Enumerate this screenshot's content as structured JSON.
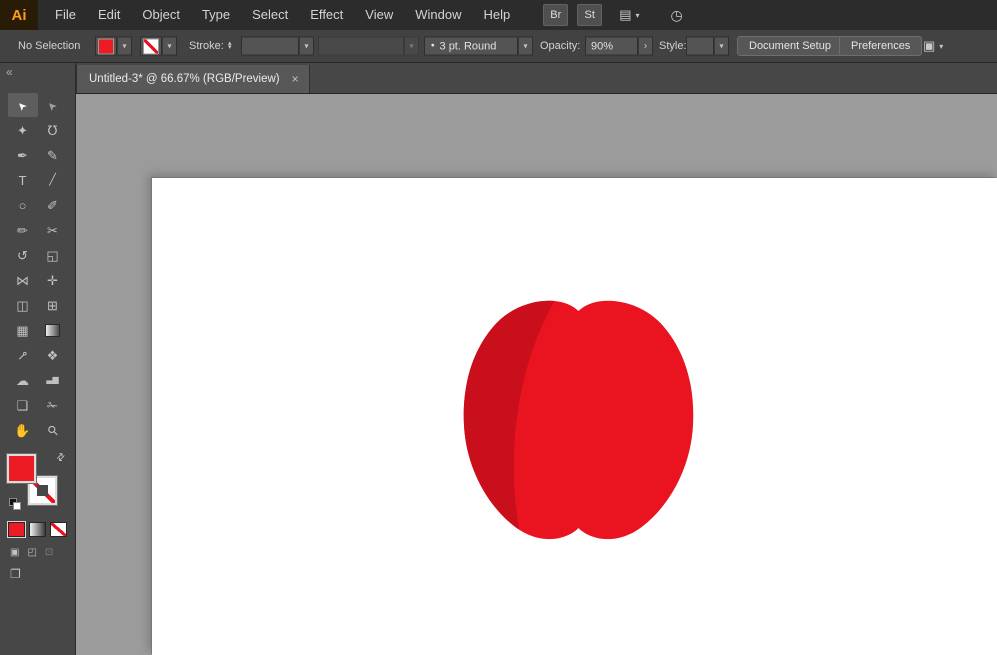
{
  "colors": {
    "swatch_red": "#ed1c24",
    "apple_fill": "#e9141f",
    "apple_shade": "#c90f1c",
    "canvas_gray": "#9b9b9b",
    "artboard_white": "#ffffff"
  },
  "app": {
    "logo_text": "Ai"
  },
  "menubar": {
    "menus": [
      "File",
      "Edit",
      "Object",
      "Type",
      "Select",
      "Effect",
      "View",
      "Window",
      "Help"
    ],
    "br_button": "Br",
    "st_button": "St"
  },
  "control_bar": {
    "selection_status": "No Selection",
    "stroke_label": "Stroke:",
    "brush_value": "3 pt. Round",
    "brush_bullet": "•",
    "opacity_label": "Opacity:",
    "opacity_value": "90%",
    "style_label": "Style:",
    "document_setup_button": "Document Setup",
    "preferences_button": "Preferences"
  },
  "tab_bar": {
    "active_tab_title": "Untitled-3* @ 66.67% (RGB/Preview)"
  },
  "icons": {
    "caret": "▾",
    "collapse": "«",
    "tab_close": "×",
    "swap": "⇄",
    "stepper_up": "▴",
    "stepper_down": "▾",
    "opacity_arrow": "›",
    "arrange": "▤",
    "sync": "◷",
    "screen_mode": "❐",
    "draw_normal": "▣",
    "draw_behind": "◰",
    "draw_inside": "⊡"
  },
  "toolbar": {
    "tools": [
      {
        "name": "selection-tool",
        "glyph": "➤"
      },
      {
        "name": "direct-selection-tool",
        "glyph": "➤"
      },
      {
        "name": "magic-wand-tool",
        "glyph": "✦"
      },
      {
        "name": "lasso-tool",
        "glyph": "℧"
      },
      {
        "name": "pen-tool",
        "glyph": "✒"
      },
      {
        "name": "curvature-tool",
        "glyph": "✎"
      },
      {
        "name": "type-tool",
        "glyph": "T"
      },
      {
        "name": "line-segment-tool",
        "glyph": "╱"
      },
      {
        "name": "ellipse-tool",
        "glyph": "○"
      },
      {
        "name": "paintbrush-tool",
        "glyph": "✐"
      },
      {
        "name": "pencil-tool",
        "glyph": "✏"
      },
      {
        "name": "scissors-tool",
        "glyph": "✂"
      },
      {
        "name": "rotate-tool",
        "glyph": "↺"
      },
      {
        "name": "scale-tool",
        "glyph": "◱"
      },
      {
        "name": "width-tool",
        "glyph": "⋈"
      },
      {
        "name": "free-transform-tool",
        "glyph": "✛"
      },
      {
        "name": "shape-builder-tool",
        "glyph": "◫"
      },
      {
        "name": "perspective-grid-tool",
        "glyph": "⊞"
      },
      {
        "name": "mesh-tool",
        "glyph": "▦"
      },
      {
        "name": "gradient-tool",
        "glyph": ""
      },
      {
        "name": "eyedropper-tool",
        "glyph": "⊸"
      },
      {
        "name": "blend-tool",
        "glyph": "❖"
      },
      {
        "name": "symbol-sprayer-tool",
        "glyph": "☁"
      },
      {
        "name": "column-graph-tool",
        "glyph": "▃▆"
      },
      {
        "name": "artboard-tool",
        "glyph": "❏"
      },
      {
        "name": "slice-tool",
        "glyph": "✁"
      },
      {
        "name": "hand-tool",
        "glyph": "✋"
      },
      {
        "name": "zoom-tool",
        "glyph": "⚲"
      }
    ]
  }
}
